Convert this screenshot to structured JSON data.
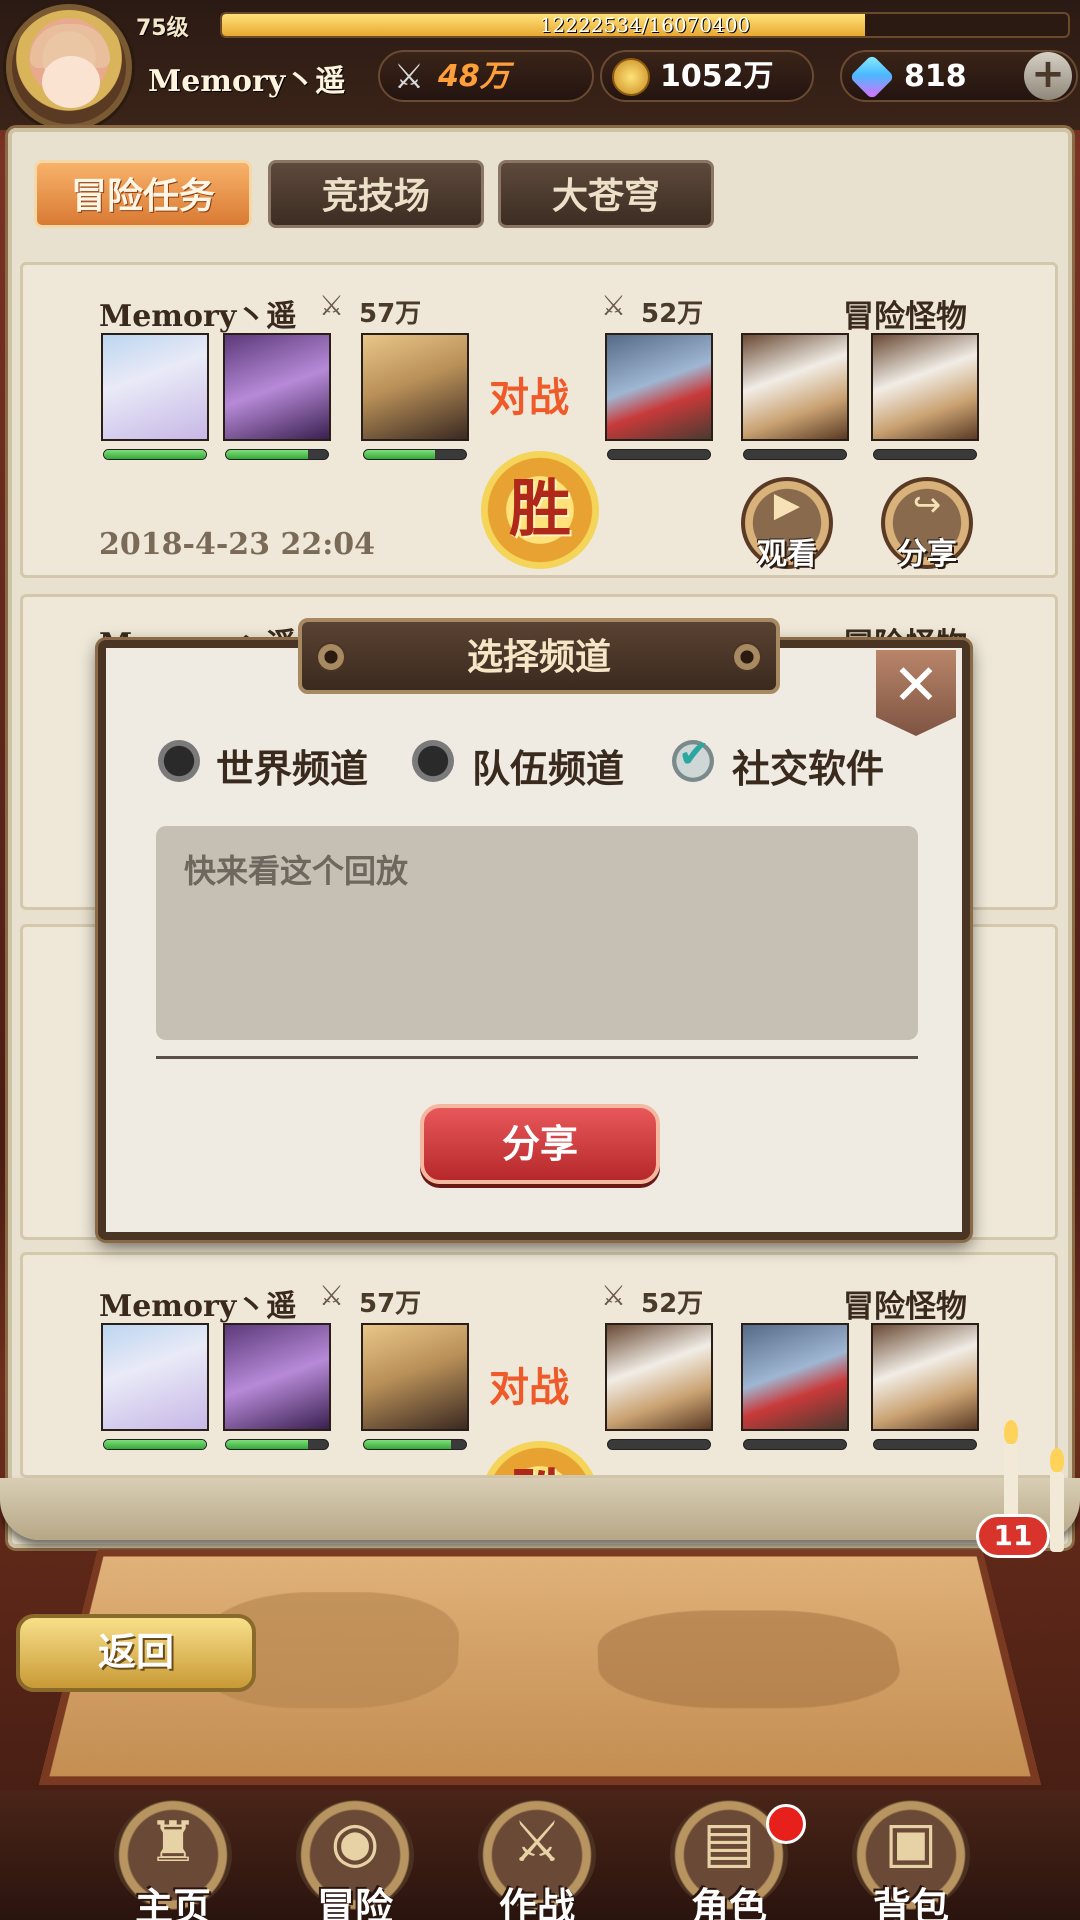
{
  "player": {
    "level": "75级",
    "exp_text": "12222534/16070400",
    "exp_fraction": 0.7606,
    "name": "Memory丶遥",
    "power": "48万",
    "gold": "1052万",
    "gems": "818",
    "plus_icon": "plus-icon"
  },
  "tabs": [
    {
      "label": "冒险任务",
      "active": true
    },
    {
      "label": "竞技场",
      "active": false
    },
    {
      "label": "大苍穹",
      "active": false
    }
  ],
  "records": [
    {
      "player_name": "Memory丶遥",
      "player_power": "57万",
      "vs_label": "对战",
      "enemy_power": "52万",
      "enemy_label": "冒险怪物",
      "hero_hp": [
        1.0,
        0.8,
        0.7
      ],
      "enemy_hp": [
        0,
        0,
        0
      ],
      "result": "胜",
      "date": "2018-4-23 22:04",
      "watch_label": "观看",
      "share_label": "分享"
    },
    {
      "player_name": "Memory丶遥",
      "enemy_label": "冒险怪物"
    },
    {
      "player_name": "Memory丶遥",
      "player_power": "57万",
      "vs_label": "对战",
      "enemy_power": "52万",
      "enemy_label": "冒险怪物",
      "hero_hp": [
        1.0,
        0.8,
        0.85
      ],
      "enemy_hp": [
        0,
        0,
        0
      ],
      "result": "胜"
    }
  ],
  "dialog": {
    "title": "选择频道",
    "options": [
      {
        "label": "世界频道",
        "checked": false
      },
      {
        "label": "队伍频道",
        "checked": false
      },
      {
        "label": "社交软件",
        "checked": true
      }
    ],
    "message": "快来看这个回放",
    "share_label": "分享",
    "close_glyph": "✕"
  },
  "back_label": "返回",
  "chat_badge": "11",
  "nav": [
    {
      "label": "主页",
      "icon": "castle-icon"
    },
    {
      "label": "冒险",
      "icon": "portal-icon"
    },
    {
      "label": "作战",
      "icon": "sword-icon"
    },
    {
      "label": "角色",
      "icon": "book-icon"
    },
    {
      "label": "背包",
      "icon": "bag-icon"
    }
  ],
  "colors": {
    "accent_orange": "#d97a34",
    "vs_red": "#ef5a2a",
    "share_red": "#b7282a",
    "hp_green": "#35a839"
  }
}
